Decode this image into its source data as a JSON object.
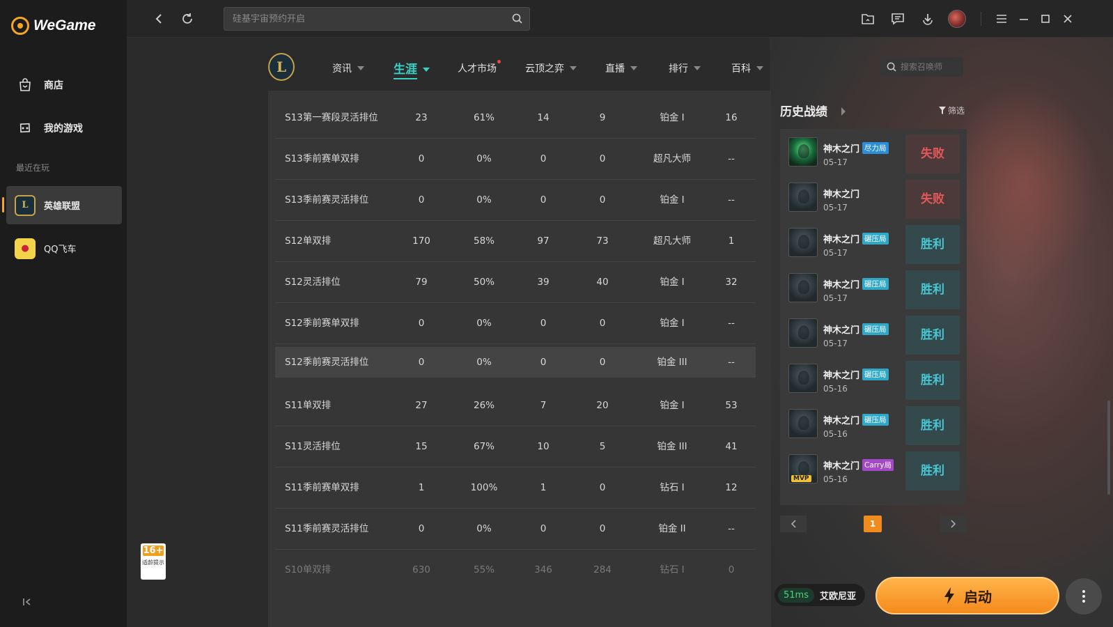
{
  "app": {
    "name": "WeGame"
  },
  "sidebar": {
    "items": [
      {
        "label": "商店",
        "icon": "shop-bag-icon"
      },
      {
        "label": "我的游戏",
        "icon": "gamepad-icon"
      }
    ],
    "recent_label": "最近在玩",
    "games": [
      {
        "label": "英雄联盟",
        "icon": "lol-icon",
        "active": true
      },
      {
        "label": "QQ飞车",
        "icon": "qq-speed-icon",
        "active": false
      }
    ]
  },
  "topbar": {
    "search_placeholder": "硅基宇宙预约开启"
  },
  "game_nav": {
    "logo": "L",
    "items": [
      {
        "label": "资讯",
        "active": false
      },
      {
        "label": "生涯",
        "active": true
      },
      {
        "label": "人才市场",
        "active": false,
        "dot": true
      },
      {
        "label": "云顶之弈",
        "active": false
      },
      {
        "label": "直播",
        "active": false
      },
      {
        "label": "排行",
        "active": false
      },
      {
        "label": "百科",
        "active": false
      }
    ],
    "search_placeholder": "搜索召唤师"
  },
  "stats_table": {
    "rows": [
      [
        "S13第一赛段灵活排位",
        "23",
        "61%",
        "14",
        "9",
        "铂金 I",
        "16"
      ],
      [
        "S13季前赛单双排",
        "0",
        "0%",
        "0",
        "0",
        "超凡大师",
        "--"
      ],
      [
        "S13季前赛灵活排位",
        "0",
        "0%",
        "0",
        "0",
        "铂金 I",
        "--"
      ],
      [
        "S12单双排",
        "170",
        "58%",
        "97",
        "73",
        "超凡大师",
        "1"
      ],
      [
        "S12灵活排位",
        "79",
        "50%",
        "39",
        "40",
        "铂金 I",
        "32"
      ],
      [
        "S12季前赛单双排",
        "0",
        "0%",
        "0",
        "0",
        "铂金 I",
        "--"
      ],
      [
        "S12季前赛灵活排位",
        "0",
        "0%",
        "0",
        "0",
        "铂金 III",
        "--"
      ],
      [
        "S11单双排",
        "27",
        "26%",
        "7",
        "20",
        "铂金 I",
        "53"
      ],
      [
        "S11灵活排位",
        "15",
        "67%",
        "10",
        "5",
        "铂金 III",
        "41"
      ],
      [
        "S11季前赛单双排",
        "1",
        "100%",
        "1",
        "0",
        "钻石 I",
        "12"
      ],
      [
        "S11季前赛灵活排位",
        "0",
        "0%",
        "0",
        "0",
        "铂金 II",
        "--"
      ],
      [
        "S10单双排",
        "630",
        "55%",
        "346",
        "284",
        "钻石 I",
        "0"
      ]
    ]
  },
  "history": {
    "title": "历史战绩",
    "filter_label": "筛选",
    "matches": [
      {
        "name": "神木之门",
        "tag": "尽力局",
        "tag_color": "blue",
        "date": "05-17",
        "result": "失败",
        "win": false,
        "avatar": "green",
        "mvp": ""
      },
      {
        "name": "神木之门",
        "tag": "",
        "tag_color": "",
        "date": "05-17",
        "result": "失败",
        "win": false,
        "avatar": "dark",
        "mvp": ""
      },
      {
        "name": "神木之门",
        "tag": "碾压局",
        "tag_color": "cyan",
        "date": "05-17",
        "result": "胜利",
        "win": true,
        "avatar": "dark",
        "mvp": ""
      },
      {
        "name": "神木之门",
        "tag": "碾压局",
        "tag_color": "cyan",
        "date": "05-17",
        "result": "胜利",
        "win": true,
        "avatar": "dark",
        "mvp": ""
      },
      {
        "name": "神木之门",
        "tag": "碾压局",
        "tag_color": "cyan",
        "date": "05-17",
        "result": "胜利",
        "win": true,
        "avatar": "dark",
        "mvp": ""
      },
      {
        "name": "神木之门",
        "tag": "碾压局",
        "tag_color": "cyan",
        "date": "05-16",
        "result": "胜利",
        "win": true,
        "avatar": "dark",
        "mvp": ""
      },
      {
        "name": "神木之门",
        "tag": "碾压局",
        "tag_color": "cyan",
        "date": "05-16",
        "result": "胜利",
        "win": true,
        "avatar": "dark",
        "mvp": ""
      },
      {
        "name": "神木之门",
        "tag": "Carry局",
        "tag_color": "purple",
        "date": "05-16",
        "result": "胜利",
        "win": true,
        "avatar": "dark",
        "mvp": "MVP"
      }
    ],
    "page": "1"
  },
  "launch": {
    "ping": "51ms",
    "server": "艾欧尼亚",
    "button_label": "启动"
  },
  "age_rating": {
    "age": "16+",
    "note": "适龄提示"
  },
  "colors": {
    "accent": "#3ad1c4",
    "launch": "#f58a1c",
    "win": "#49c6d4",
    "lose": "#e2575a"
  }
}
